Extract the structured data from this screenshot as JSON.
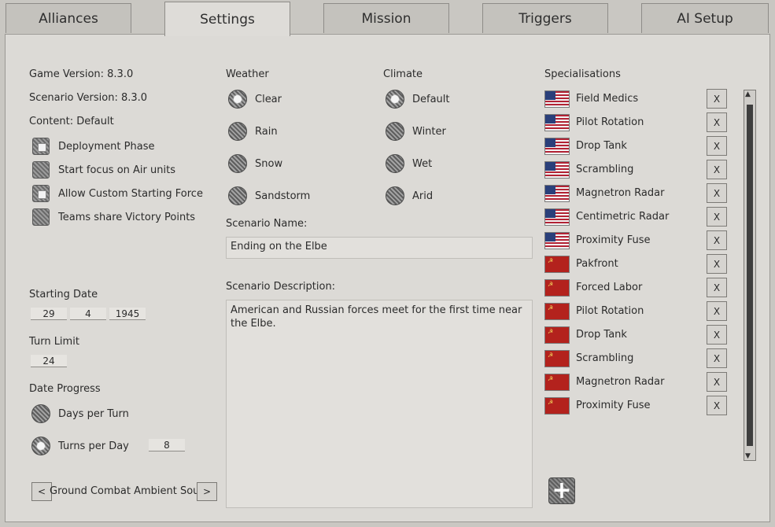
{
  "tabs": [
    "Alliances",
    "Settings",
    "Mission",
    "Triggers",
    "AI Setup"
  ],
  "active_tab": "Settings",
  "info": {
    "game_version": "Game Version: 8.3.0",
    "scenario_version": "Scenario Version: 8.3.0",
    "content": "Content: Default"
  },
  "options": [
    {
      "label": "Deployment Phase",
      "checked": true
    },
    {
      "label": "Start focus on Air units",
      "checked": false
    },
    {
      "label": "Allow Custom Starting Force",
      "checked": true
    },
    {
      "label": "Teams share Victory Points",
      "checked": false
    }
  ],
  "starting_date": {
    "label": "Starting Date",
    "day": "29",
    "month": "4",
    "year": "1945"
  },
  "turn_limit": {
    "label": "Turn Limit",
    "value": "24"
  },
  "date_progress": {
    "label": "Date Progress",
    "days_per_turn": "Days per Turn",
    "turns_per_day": "Turns per Day",
    "turns_per_day_value": "8",
    "selected": "Turns per Day"
  },
  "ambient_sound": {
    "label": "Ground Combat Ambient Sound",
    "prev": "<",
    "next": ">"
  },
  "weather": {
    "label": "Weather",
    "options": [
      "Clear",
      "Rain",
      "Snow",
      "Sandstorm"
    ],
    "selected": "Clear"
  },
  "climate": {
    "label": "Climate",
    "options": [
      "Default",
      "Winter",
      "Wet",
      "Arid"
    ],
    "selected": "Default"
  },
  "scenario_name": {
    "label": "Scenario Name:",
    "value": "Ending on the Elbe"
  },
  "scenario_description": {
    "label": "Scenario Description:",
    "value": "American and Russian forces meet for the first time near the Elbe."
  },
  "specialisations": {
    "label": "Specialisations",
    "remove_label": "X",
    "add_label": "+",
    "items": [
      {
        "flag": "us",
        "name": "Field Medics"
      },
      {
        "flag": "us",
        "name": "Pilot Rotation"
      },
      {
        "flag": "us",
        "name": "Drop Tank"
      },
      {
        "flag": "us",
        "name": "Scrambling"
      },
      {
        "flag": "us",
        "name": "Magnetron Radar"
      },
      {
        "flag": "us",
        "name": "Centimetric Radar"
      },
      {
        "flag": "us",
        "name": "Proximity Fuse"
      },
      {
        "flag": "su",
        "name": "Pakfront"
      },
      {
        "flag": "su",
        "name": "Forced Labor"
      },
      {
        "flag": "su",
        "name": "Pilot Rotation"
      },
      {
        "flag": "su",
        "name": "Drop Tank"
      },
      {
        "flag": "su",
        "name": "Scrambling"
      },
      {
        "flag": "su",
        "name": "Magnetron Radar"
      },
      {
        "flag": "su",
        "name": "Proximity Fuse"
      }
    ]
  },
  "scroll": {
    "up": "▲",
    "down": "▼"
  }
}
